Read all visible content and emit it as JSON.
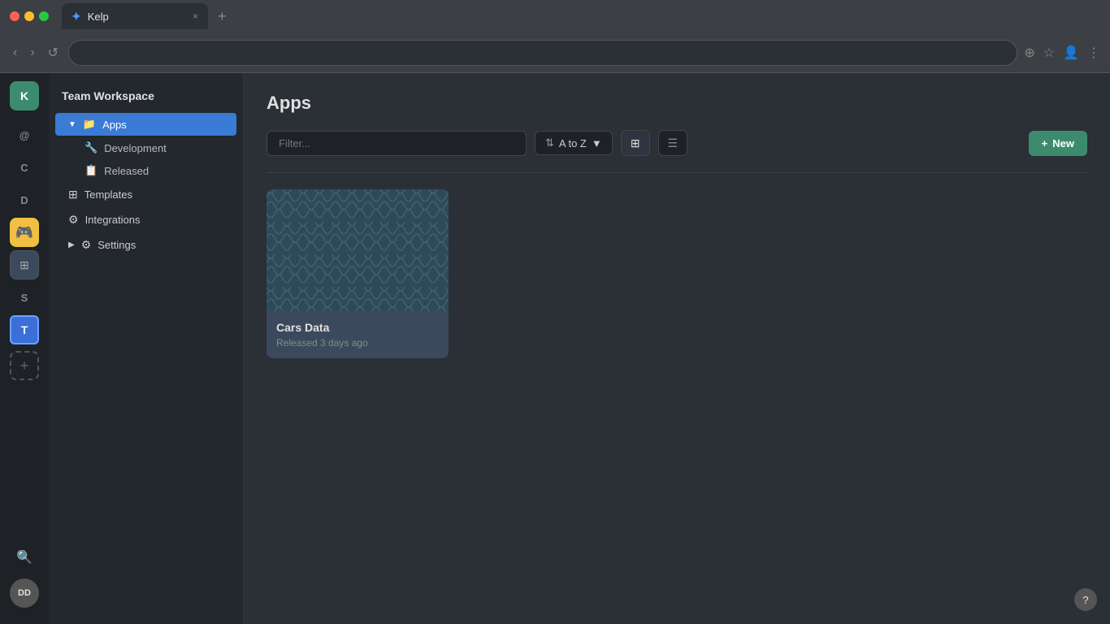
{
  "browser": {
    "tab_title": "Kelp",
    "tab_icon": "✦",
    "close_icon": "×",
    "new_tab_icon": "+",
    "back_icon": "‹",
    "forward_icon": "›",
    "reload_icon": "↺",
    "zoom_icon": "⊕",
    "star_icon": "☆",
    "profile_icon": "👤",
    "menu_icon": "⋮"
  },
  "icon_sidebar": {
    "workspace_label": "K",
    "items": [
      {
        "id": "at",
        "label": "@",
        "active": false
      },
      {
        "id": "c",
        "label": "C",
        "active": false
      },
      {
        "id": "d",
        "label": "D",
        "active": false
      },
      {
        "id": "koodi",
        "label": "🟨",
        "active": false
      },
      {
        "id": "grid",
        "label": "⊞",
        "active": false
      },
      {
        "id": "s",
        "label": "S",
        "active": false
      },
      {
        "id": "t",
        "label": "T",
        "active": true
      }
    ],
    "add_label": "+",
    "search_icon": "🔍",
    "avatar_label": "DD"
  },
  "sidebar": {
    "workspace_title": "Team Workspace",
    "items": [
      {
        "id": "apps",
        "label": "Apps",
        "icon": "📁",
        "active": true,
        "expanded": true
      },
      {
        "id": "development",
        "label": "Development",
        "icon": "🔧",
        "sub": true
      },
      {
        "id": "released",
        "label": "Released",
        "icon": "📋",
        "sub": true
      },
      {
        "id": "templates",
        "label": "Templates",
        "icon": "⊞",
        "active": false
      },
      {
        "id": "integrations",
        "label": "Integrations",
        "icon": "⚙",
        "active": false
      },
      {
        "id": "settings",
        "label": "Settings",
        "icon": "⚙",
        "active": false,
        "expanded": false
      }
    ]
  },
  "main": {
    "page_title": "Apps",
    "filter_placeholder": "Filter...",
    "sort_label": "A to Z",
    "sort_icon": "▼",
    "grid_view_icon": "⊞",
    "list_view_icon": "☰",
    "new_button_label": "New",
    "new_button_icon": "+"
  },
  "cards": [
    {
      "id": "cars-data",
      "title": "Cars Data",
      "subtitle": "Released 3 days ago"
    }
  ],
  "help": {
    "icon": "?"
  }
}
